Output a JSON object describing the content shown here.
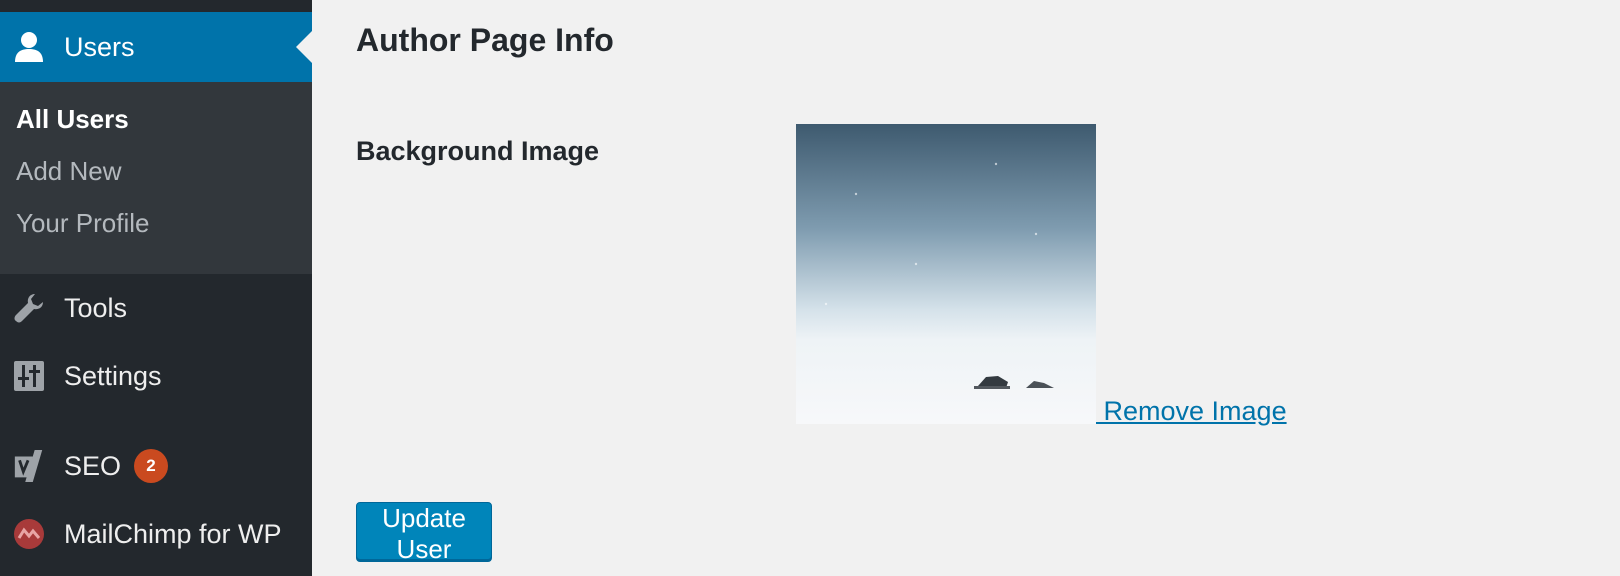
{
  "sidebar": {
    "users_label": "Users",
    "submenu": {
      "all_users": "All Users",
      "add_new": "Add New",
      "your_profile": "Your Profile"
    },
    "tools_label": "Tools",
    "settings_label": "Settings",
    "seo_label": "SEO",
    "seo_badge": "2",
    "mailchimp_label": "MailChimp for WP",
    "icons": {
      "users": "user-icon",
      "tools": "wrench-icon",
      "settings": "sliders-icon",
      "seo": "yoast-icon",
      "mailchimp": "mailchimp-icon"
    }
  },
  "main": {
    "title": "Author Page Info",
    "background_label": "Background Image",
    "remove_link": " Remove Image",
    "update_button": "Update User"
  },
  "colors": {
    "sidebar_bg": "#23282d",
    "submenu_bg": "#32373c",
    "accent": "#0073aa",
    "badge": "#ca4a1f",
    "button": "#0085ba"
  }
}
